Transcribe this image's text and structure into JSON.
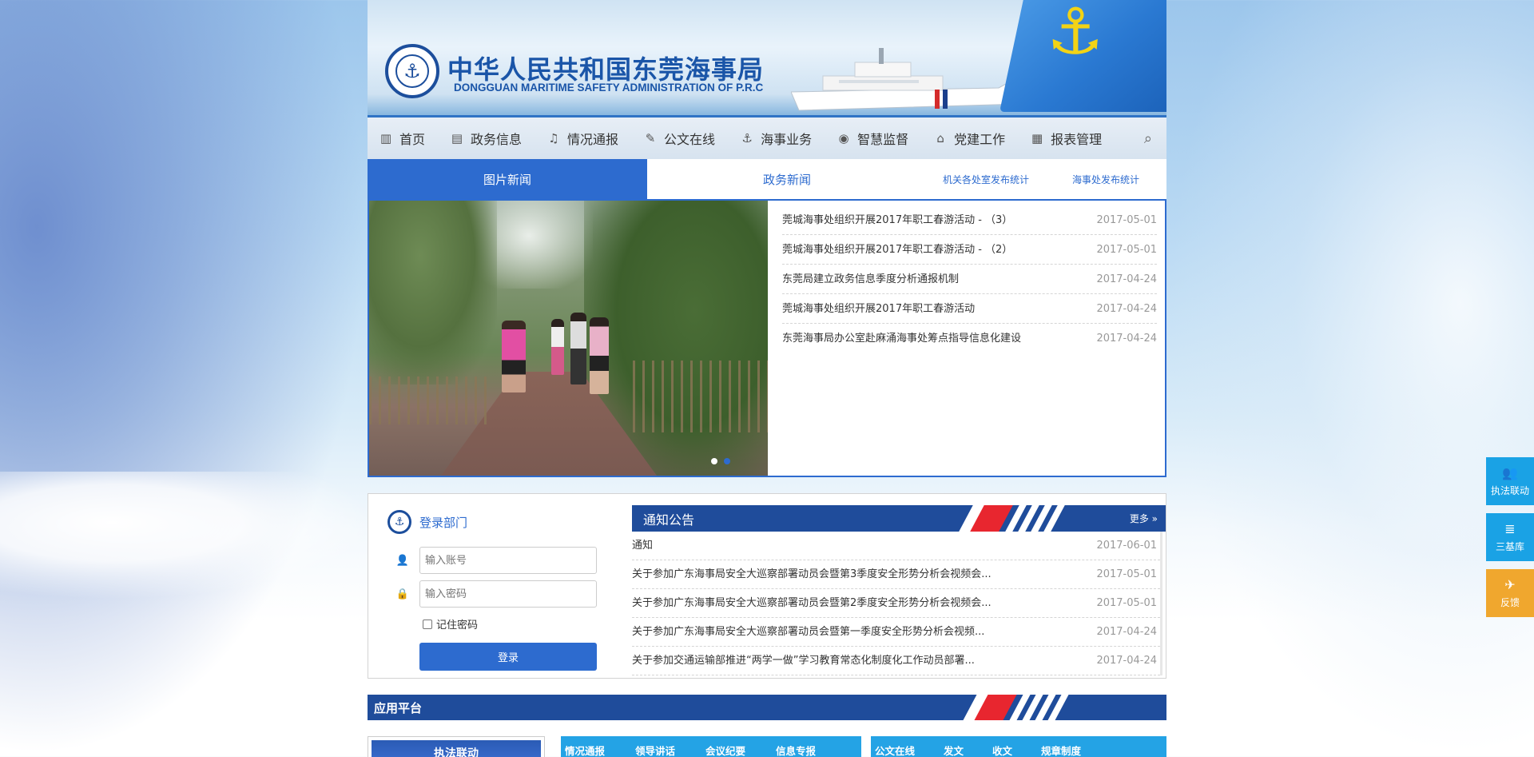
{
  "header": {
    "title_cn": "中华人民共和国东莞海事局",
    "title_en": "DONGGUAN MARITIME SAFETY ADMINISTRATION OF P.R.C"
  },
  "nav": {
    "items": [
      {
        "label": "首页",
        "icon": "building-icon"
      },
      {
        "label": "政务信息",
        "icon": "document-grid-icon"
      },
      {
        "label": "情况通报",
        "icon": "bell-icon"
      },
      {
        "label": "公文在线",
        "icon": "edit-icon"
      },
      {
        "label": "海事业务",
        "icon": "anchor-icon"
      },
      {
        "label": "智慧监督",
        "icon": "eye-icon"
      },
      {
        "label": "党建工作",
        "icon": "bank-icon"
      },
      {
        "label": "报表管理",
        "icon": "clipboard-icon"
      }
    ],
    "search_icon": "search-icon"
  },
  "news": {
    "tabs": {
      "pictures": "图片新闻",
      "gov": "政务新闻",
      "stat1": "机关各处室发布统计",
      "stat2": "海事处发布统计"
    },
    "items": [
      {
        "title": "莞城海事处组织开展2017年职工春游活动 - （3）",
        "date": "2017-05-01"
      },
      {
        "title": "莞城海事处组织开展2017年职工春游活动 - （2）",
        "date": "2017-05-01"
      },
      {
        "title": "东莞局建立政务信息季度分析通报机制",
        "date": "2017-04-24"
      },
      {
        "title": "莞城海事处组织开展2017年职工春游活动",
        "date": "2017-04-24"
      },
      {
        "title": "东莞海事局办公室赴麻涌海事处筹点指导信息化建设",
        "date": "2017-04-24"
      }
    ]
  },
  "login": {
    "title": "登录部门",
    "account_placeholder": "输入账号",
    "password_placeholder": "输入密码",
    "remember": "记住密码",
    "button": "登录"
  },
  "notice": {
    "title": "通知公告",
    "more": "更多 »",
    "items": [
      {
        "title": "通知",
        "date": "2017-06-01"
      },
      {
        "title": "关于参加广东海事局安全大巡察部署动员会暨第3季度安全形势分析会视频会...",
        "date": "2017-05-01"
      },
      {
        "title": "关于参加广东海事局安全大巡察部署动员会暨第2季度安全形势分析会视频会...",
        "date": "2017-05-01"
      },
      {
        "title": "关于参加广东海事局安全大巡察部署动员会暨第一季度安全形势分析会视频...",
        "date": "2017-04-24"
      },
      {
        "title": "关于参加交通运输部推进“两学一做”学习教育常态化制度化工作动员部署...",
        "date": "2017-04-24"
      }
    ]
  },
  "apps": {
    "title": "应用平台",
    "card1": "执法联动",
    "card2_tabs": [
      "情况通报",
      "领导讲话",
      "会议纪要",
      "信息专报"
    ],
    "card3_tabs": [
      "公文在线",
      "发文",
      "收文",
      "规章制度"
    ]
  },
  "float": {
    "items": [
      {
        "label": "执法联动",
        "icon": "users-icon"
      },
      {
        "label": "三基库",
        "icon": "database-icon"
      },
      {
        "label": "反馈",
        "icon": "runner-icon"
      }
    ]
  },
  "colors": {
    "primary": "#2d6bcf",
    "dark_bar": "#1f4c9b",
    "accent_red": "#e8262f",
    "float_blue": "#1aa2e5",
    "float_orange": "#f0a72e"
  }
}
